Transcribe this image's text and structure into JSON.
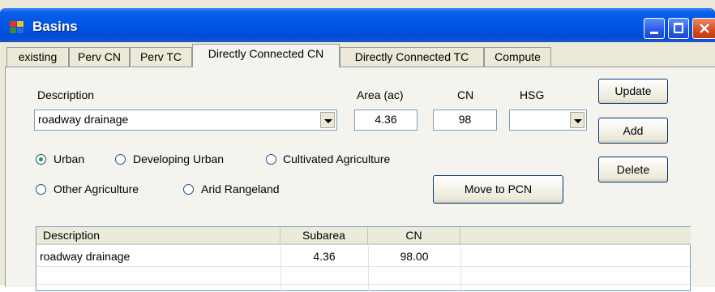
{
  "window": {
    "title": "Basins"
  },
  "tabs": [
    {
      "label": "existing",
      "active": false
    },
    {
      "label": "Perv CN",
      "active": false
    },
    {
      "label": "Perv TC",
      "active": false
    },
    {
      "label": "Directly Connected CN",
      "active": true
    },
    {
      "label": "Directly Connected TC",
      "active": false
    },
    {
      "label": "Compute",
      "active": false
    }
  ],
  "form": {
    "description_label": "Description",
    "description_value": "roadway drainage",
    "area_label": "Area (ac)",
    "area_value": "4.36",
    "cn_label": "CN",
    "cn_value": "98",
    "hsg_label": "HSG",
    "hsg_value": ""
  },
  "buttons": {
    "update": "Update",
    "add": "Add",
    "delete": "Delete",
    "move_to_pcn": "Move to PCN"
  },
  "land_use": {
    "selected": "Urban",
    "options": [
      "Urban",
      "Developing Urban",
      "Cultivated Agriculture",
      "Other Agriculture",
      "Arid Rangeland"
    ]
  },
  "table": {
    "columns": [
      "Description",
      "Subarea",
      "CN"
    ],
    "rows": [
      [
        "roadway drainage",
        "4.36",
        "98.00"
      ]
    ]
  },
  "colors": {
    "title_bar": "#0055e5",
    "window_bg": "#ece9d8",
    "radio_dot": "#21a121",
    "close_button": "#d84a20"
  }
}
